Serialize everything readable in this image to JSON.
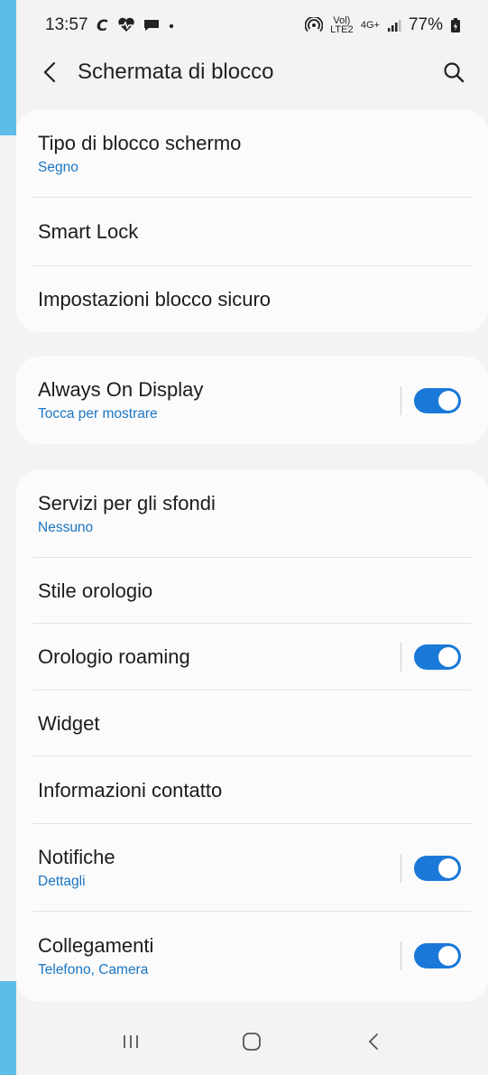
{
  "status_bar": {
    "time": "13:57",
    "left_icons": [
      "carrier-c-icon",
      "heartbeat-icon",
      "chat-bubble-icon",
      "dot-icon"
    ],
    "volte_label": "Vol) LTE2",
    "network_label": "4G+",
    "battery": "77%"
  },
  "header": {
    "title": "Schermata di blocco"
  },
  "groups": [
    {
      "items": [
        {
          "title": "Tipo di blocco schermo",
          "subtitle": "Segno",
          "toggle": null
        },
        {
          "title": "Smart Lock",
          "subtitle": null,
          "toggle": null
        },
        {
          "title": "Impostazioni blocco sicuro",
          "subtitle": null,
          "toggle": null
        }
      ]
    },
    {
      "items": [
        {
          "title": "Always On Display",
          "subtitle": "Tocca per mostrare",
          "toggle": true
        }
      ]
    },
    {
      "items": [
        {
          "title": "Servizi per gli sfondi",
          "subtitle": "Nessuno",
          "toggle": null
        },
        {
          "title": "Stile orologio",
          "subtitle": null,
          "toggle": null
        },
        {
          "title": "Orologio roaming",
          "subtitle": null,
          "toggle": true
        },
        {
          "title": "Widget",
          "subtitle": null,
          "toggle": null
        },
        {
          "title": "Informazioni contatto",
          "subtitle": null,
          "toggle": null
        },
        {
          "title": "Notifiche",
          "subtitle": "Dettagli",
          "toggle": true
        },
        {
          "title": "Collegamenti",
          "subtitle": "Telefono, Camera",
          "toggle": true
        }
      ]
    }
  ],
  "colors": {
    "accent": "#1978d8",
    "subtitle": "#1b76c4",
    "background": "#f3f3f3",
    "card": "#fbfbfb",
    "edge_strip": "#5dbde6"
  },
  "nav_bar": {
    "buttons": [
      "recent-apps-icon",
      "home-icon",
      "back-icon"
    ]
  }
}
